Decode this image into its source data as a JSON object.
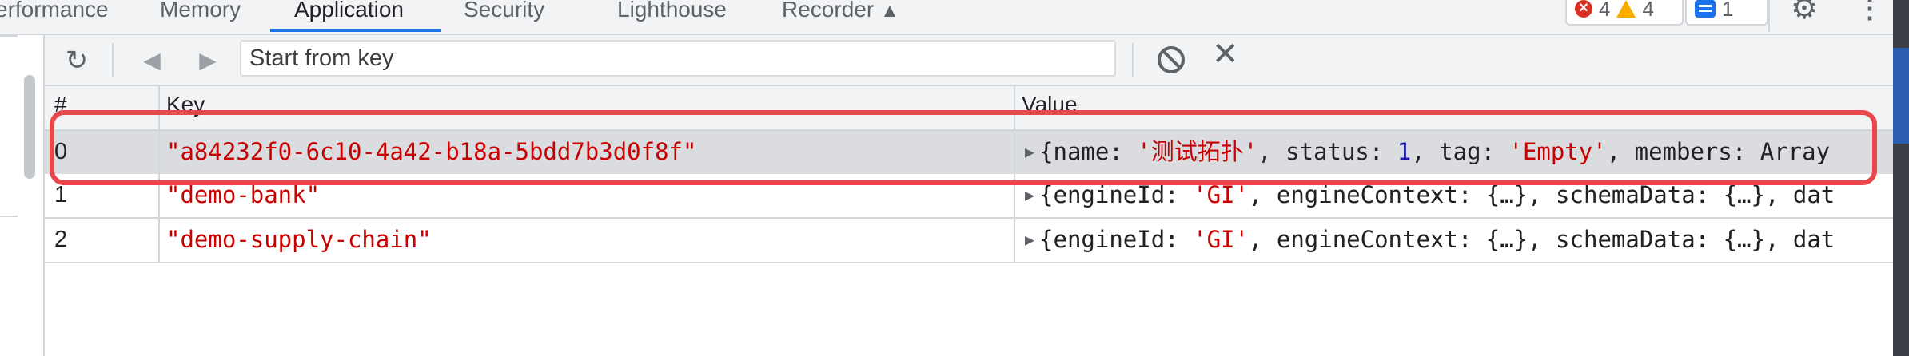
{
  "tabs": [
    {
      "label": "Performance"
    },
    {
      "label": "Memory"
    },
    {
      "label": "Application"
    },
    {
      "label": "Security"
    },
    {
      "label": "Lighthouse"
    },
    {
      "label": "Recorder"
    }
  ],
  "tab_cropped_text": "erformance",
  "status_badges": {
    "errors": "4",
    "warnings": "4",
    "messages": "1"
  },
  "icons": [
    "reload-icon",
    "prev-icon",
    "next-icon",
    "clear-icon",
    "close-icon",
    "settings-icon",
    "more-icon",
    "warning-icon",
    "error-icon",
    "message-icon"
  ],
  "toolbar": {
    "search_placeholder": "Start from key"
  },
  "table": {
    "columns": [
      "#",
      "Key",
      "Value"
    ],
    "rows": [
      {
        "index": "0",
        "key": "\"a84232f0-6c10-4a42-b18a-5bdd7b3d0f8f\"",
        "value": {
          "name": "'测试拓扑'",
          "status": "1",
          "tag": "'Empty'",
          "members_prefix": "members: Array"
        }
      },
      {
        "index": "1",
        "key": "\"demo-bank\"",
        "value": {
          "engineId": "'GI'",
          "rest": ", engineContext: {…}, schemaData: {…}, dat"
        }
      },
      {
        "index": "2",
        "key": "\"demo-supply-chain\"",
        "value": {
          "engineId": "'GI'",
          "rest": ", engineContext: {…}, schemaData: {…}, dat"
        }
      }
    ]
  },
  "colors": {
    "accent": "#1a73e8",
    "highlight_box": "#e8474c",
    "string_value": "#c80000",
    "number_value": "#1a1aa6"
  }
}
